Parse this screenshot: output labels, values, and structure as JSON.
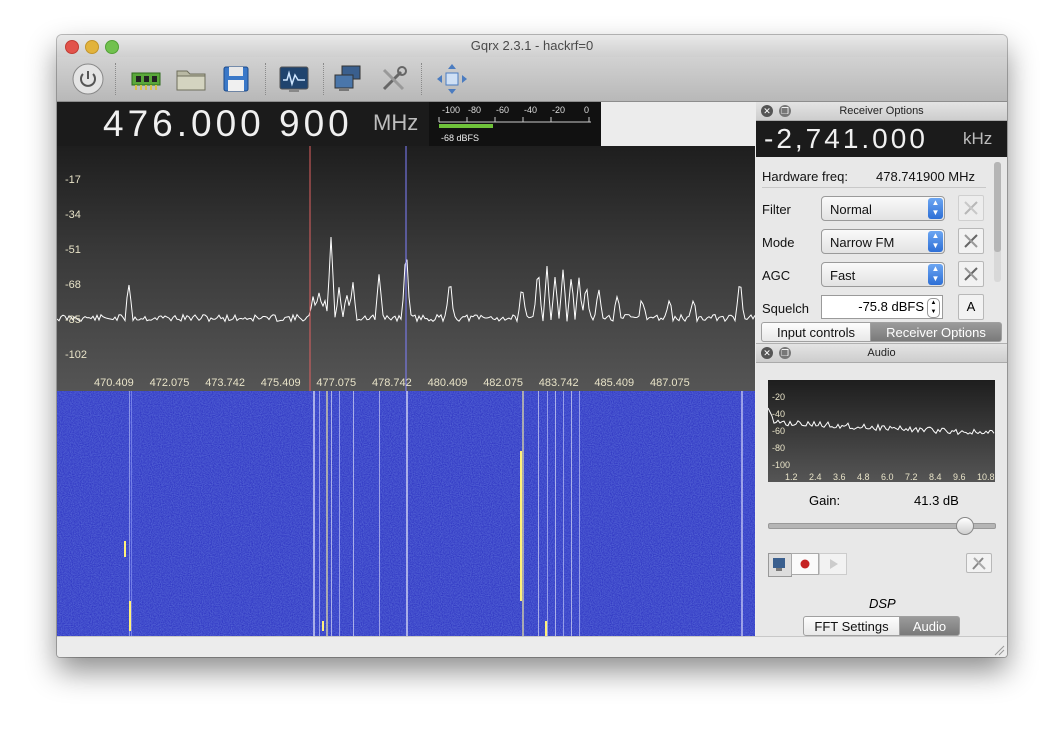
{
  "window": {
    "title": "Gqrx 2.3.1 - hackrf=0"
  },
  "toolbar": {
    "buttons": [
      "power-icon",
      "hardware-icon",
      "folder-icon",
      "save-icon",
      "fft-icon",
      "network-icon",
      "tools-icon",
      "fullscreen-icon"
    ]
  },
  "frequency": {
    "value": "476.000 900",
    "unit": "MHz"
  },
  "meter": {
    "ticks": [
      "-100",
      "-80",
      "-60",
      "-40",
      "-20",
      "0"
    ],
    "level_text": "-68 dBFS",
    "level_fraction": 0.32
  },
  "plot": {
    "y_ticks": [
      "-17",
      "-34",
      "-51",
      "-68",
      "-85",
      "-102"
    ],
    "x_ticks": [
      "470.409",
      "472.075",
      "473.742",
      "475.409",
      "477.075",
      "478.742",
      "480.409",
      "482.075",
      "483.742",
      "485.409",
      "487.075"
    ],
    "colors": {
      "trace": "#ffffff",
      "center_line": "#e06060",
      "filter_line": "#8080ff",
      "waterfall_bg": "#2a2fc0"
    }
  },
  "receiver": {
    "dock_title": "Receiver Options",
    "offset": "-2,741.000",
    "offset_unit": "kHz",
    "hw_label": "Hardware freq:",
    "hw_value": "478.741900 MHz",
    "filter_label": "Filter",
    "filter_value": "Normal",
    "mode_label": "Mode",
    "mode_value": "Narrow FM",
    "agc_label": "AGC",
    "agc_value": "Fast",
    "squelch_label": "Squelch",
    "squelch_value": "-75.8 dBFS",
    "squelch_auto": "A",
    "tabs": [
      "Input controls",
      "Receiver Options"
    ],
    "active_tab": "Receiver Options"
  },
  "audio": {
    "dock_title": "Audio",
    "y_ticks": [
      "-20",
      "-40",
      "-60",
      "-80",
      "-100"
    ],
    "x_ticks": [
      "1.2",
      "2.4",
      "3.6",
      "4.8",
      "6.0",
      "7.2",
      "8.4",
      "9.6",
      "10.8"
    ],
    "gain_label": "Gain:",
    "gain_value": "41.3 dB",
    "gain_fraction": 0.89,
    "dsp_label": "DSP",
    "tabs": [
      "FFT Settings",
      "Audio"
    ],
    "active_tab": "Audio"
  }
}
